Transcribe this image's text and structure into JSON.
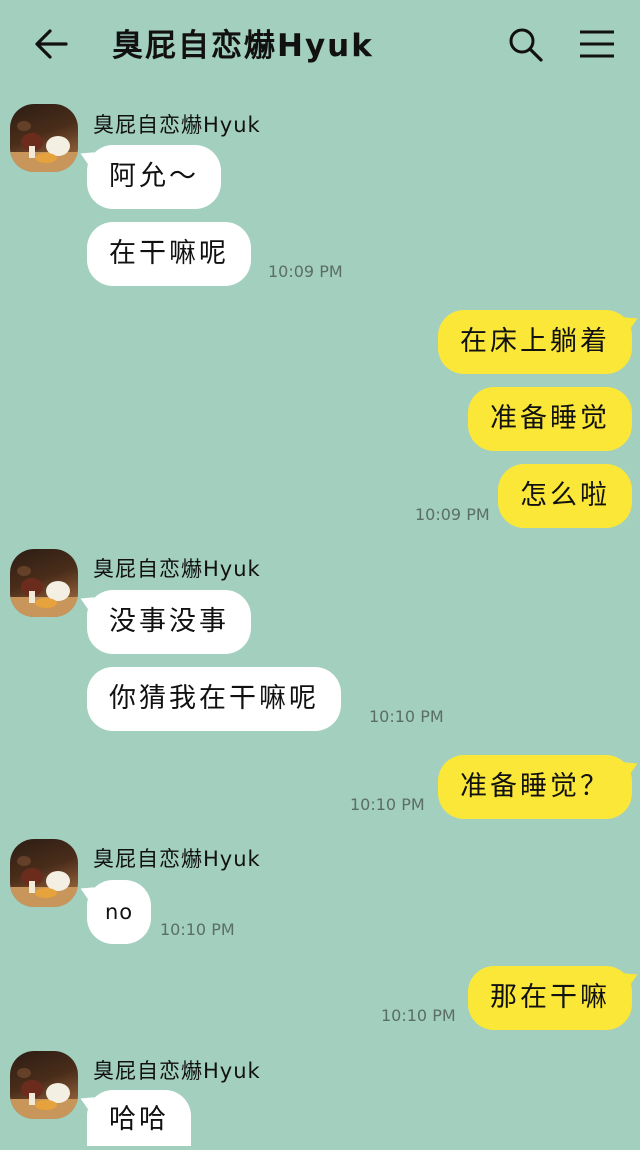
{
  "header": {
    "title": "臭屁自恋爀Hyuk"
  },
  "messages": [
    {
      "sender": "臭屁自恋爀Hyuk",
      "text": "阿允～"
    },
    {
      "text": "在干嘛呢",
      "time": "10:09 PM"
    },
    {
      "text": "在床上躺着"
    },
    {
      "text": "准备睡觉"
    },
    {
      "text": "怎么啦",
      "time": "10:09 PM"
    },
    {
      "sender": "臭屁自恋爀Hyuk",
      "text": "没事没事"
    },
    {
      "text": "你猜我在干嘛呢",
      "time": "10:10 PM"
    },
    {
      "text": "准备睡觉？",
      "time": "10:10 PM"
    },
    {
      "sender": "臭屁自恋爀Hyuk",
      "text": "no",
      "time": "10:10 PM"
    },
    {
      "text": "那在干嘛",
      "time": "10:10 PM"
    },
    {
      "sender": "臭屁自恋爀Hyuk",
      "text": "哈哈"
    }
  ],
  "colors": {
    "background": "#a3cfbf",
    "outgoing_bubble": "#fbe737",
    "incoming_bubble": "#ffffff"
  }
}
